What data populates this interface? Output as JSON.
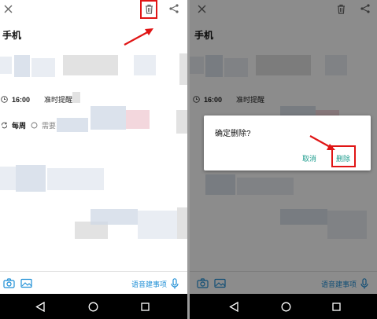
{
  "note": {
    "title": "手机",
    "reminder_time": "16:00",
    "reminder_label": "准时提醒",
    "repeat_label": "每周",
    "repeat_extra": "需要"
  },
  "bottom": {
    "voice_label": "语音建事项"
  },
  "dialog": {
    "title": "确定删除?",
    "cancel_label": "取消",
    "delete_label": "删除"
  },
  "icons": {
    "close": "close-icon",
    "trash": "trash-icon",
    "share": "share-icon",
    "camera": "camera-icon",
    "image": "image-icon",
    "mic": "mic-icon",
    "clock": "clock-icon",
    "repeat": "repeat-icon",
    "back": "back-icon",
    "home": "home-icon",
    "recents": "recents-icon"
  },
  "colors": {
    "accent_blue": "#1f8fd6",
    "dialog_button": "#1f9e8f",
    "annotation_red": "#e01515",
    "overlay": "rgba(0,0,0,0.45)"
  }
}
